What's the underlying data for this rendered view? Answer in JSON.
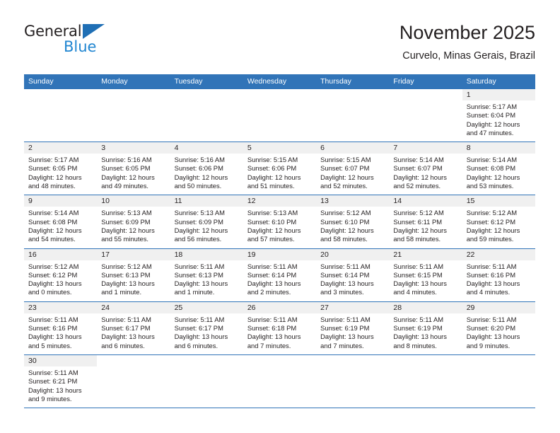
{
  "logo": {
    "word_top": "General",
    "word_bottom": "Blue",
    "icon": "triangle-flag-icon",
    "colors": {
      "black": "#231f20",
      "blue": "#2186d1",
      "flag": "#1f6fb5"
    }
  },
  "header": {
    "title": "November 2025",
    "subtitle": "Curvelo, Minas Gerais, Brazil"
  },
  "theme": {
    "header_blue": "#3174b8",
    "day_band_gray": "#f0f0f0",
    "text": "#231f20"
  },
  "weekdays": [
    "Sunday",
    "Monday",
    "Tuesday",
    "Wednesday",
    "Thursday",
    "Friday",
    "Saturday"
  ],
  "weeks": [
    [
      {
        "day": "",
        "empty": true,
        "blank": true,
        "sunrise": "",
        "sunset": "",
        "daylight_1": "",
        "daylight_2": ""
      },
      {
        "day": "",
        "empty": true,
        "blank": true,
        "sunrise": "",
        "sunset": "",
        "daylight_1": "",
        "daylight_2": ""
      },
      {
        "day": "",
        "empty": true,
        "blank": true,
        "sunrise": "",
        "sunset": "",
        "daylight_1": "",
        "daylight_2": ""
      },
      {
        "day": "",
        "empty": true,
        "blank": true,
        "sunrise": "",
        "sunset": "",
        "daylight_1": "",
        "daylight_2": ""
      },
      {
        "day": "",
        "empty": true,
        "blank": true,
        "sunrise": "",
        "sunset": "",
        "daylight_1": "",
        "daylight_2": ""
      },
      {
        "day": "",
        "empty": true,
        "blank": true,
        "sunrise": "",
        "sunset": "",
        "daylight_1": "",
        "daylight_2": ""
      },
      {
        "day": "1",
        "sunrise": "Sunrise: 5:17 AM",
        "sunset": "Sunset: 6:04 PM",
        "daylight_1": "Daylight: 12 hours",
        "daylight_2": "and 47 minutes."
      }
    ],
    [
      {
        "day": "2",
        "sunrise": "Sunrise: 5:17 AM",
        "sunset": "Sunset: 6:05 PM",
        "daylight_1": "Daylight: 12 hours",
        "daylight_2": "and 48 minutes."
      },
      {
        "day": "3",
        "sunrise": "Sunrise: 5:16 AM",
        "sunset": "Sunset: 6:05 PM",
        "daylight_1": "Daylight: 12 hours",
        "daylight_2": "and 49 minutes."
      },
      {
        "day": "4",
        "sunrise": "Sunrise: 5:16 AM",
        "sunset": "Sunset: 6:06 PM",
        "daylight_1": "Daylight: 12 hours",
        "daylight_2": "and 50 minutes."
      },
      {
        "day": "5",
        "sunrise": "Sunrise: 5:15 AM",
        "sunset": "Sunset: 6:06 PM",
        "daylight_1": "Daylight: 12 hours",
        "daylight_2": "and 51 minutes."
      },
      {
        "day": "6",
        "sunrise": "Sunrise: 5:15 AM",
        "sunset": "Sunset: 6:07 PM",
        "daylight_1": "Daylight: 12 hours",
        "daylight_2": "and 52 minutes."
      },
      {
        "day": "7",
        "sunrise": "Sunrise: 5:14 AM",
        "sunset": "Sunset: 6:07 PM",
        "daylight_1": "Daylight: 12 hours",
        "daylight_2": "and 52 minutes."
      },
      {
        "day": "8",
        "sunrise": "Sunrise: 5:14 AM",
        "sunset": "Sunset: 6:08 PM",
        "daylight_1": "Daylight: 12 hours",
        "daylight_2": "and 53 minutes."
      }
    ],
    [
      {
        "day": "9",
        "sunrise": "Sunrise: 5:14 AM",
        "sunset": "Sunset: 6:08 PM",
        "daylight_1": "Daylight: 12 hours",
        "daylight_2": "and 54 minutes."
      },
      {
        "day": "10",
        "sunrise": "Sunrise: 5:13 AM",
        "sunset": "Sunset: 6:09 PM",
        "daylight_1": "Daylight: 12 hours",
        "daylight_2": "and 55 minutes."
      },
      {
        "day": "11",
        "sunrise": "Sunrise: 5:13 AM",
        "sunset": "Sunset: 6:09 PM",
        "daylight_1": "Daylight: 12 hours",
        "daylight_2": "and 56 minutes."
      },
      {
        "day": "12",
        "sunrise": "Sunrise: 5:13 AM",
        "sunset": "Sunset: 6:10 PM",
        "daylight_1": "Daylight: 12 hours",
        "daylight_2": "and 57 minutes."
      },
      {
        "day": "13",
        "sunrise": "Sunrise: 5:12 AM",
        "sunset": "Sunset: 6:10 PM",
        "daylight_1": "Daylight: 12 hours",
        "daylight_2": "and 58 minutes."
      },
      {
        "day": "14",
        "sunrise": "Sunrise: 5:12 AM",
        "sunset": "Sunset: 6:11 PM",
        "daylight_1": "Daylight: 12 hours",
        "daylight_2": "and 58 minutes."
      },
      {
        "day": "15",
        "sunrise": "Sunrise: 5:12 AM",
        "sunset": "Sunset: 6:12 PM",
        "daylight_1": "Daylight: 12 hours",
        "daylight_2": "and 59 minutes."
      }
    ],
    [
      {
        "day": "16",
        "sunrise": "Sunrise: 5:12 AM",
        "sunset": "Sunset: 6:12 PM",
        "daylight_1": "Daylight: 13 hours",
        "daylight_2": "and 0 minutes."
      },
      {
        "day": "17",
        "sunrise": "Sunrise: 5:12 AM",
        "sunset": "Sunset: 6:13 PM",
        "daylight_1": "Daylight: 13 hours",
        "daylight_2": "and 1 minute."
      },
      {
        "day": "18",
        "sunrise": "Sunrise: 5:11 AM",
        "sunset": "Sunset: 6:13 PM",
        "daylight_1": "Daylight: 13 hours",
        "daylight_2": "and 1 minute."
      },
      {
        "day": "19",
        "sunrise": "Sunrise: 5:11 AM",
        "sunset": "Sunset: 6:14 PM",
        "daylight_1": "Daylight: 13 hours",
        "daylight_2": "and 2 minutes."
      },
      {
        "day": "20",
        "sunrise": "Sunrise: 5:11 AM",
        "sunset": "Sunset: 6:14 PM",
        "daylight_1": "Daylight: 13 hours",
        "daylight_2": "and 3 minutes."
      },
      {
        "day": "21",
        "sunrise": "Sunrise: 5:11 AM",
        "sunset": "Sunset: 6:15 PM",
        "daylight_1": "Daylight: 13 hours",
        "daylight_2": "and 4 minutes."
      },
      {
        "day": "22",
        "sunrise": "Sunrise: 5:11 AM",
        "sunset": "Sunset: 6:16 PM",
        "daylight_1": "Daylight: 13 hours",
        "daylight_2": "and 4 minutes."
      }
    ],
    [
      {
        "day": "23",
        "sunrise": "Sunrise: 5:11 AM",
        "sunset": "Sunset: 6:16 PM",
        "daylight_1": "Daylight: 13 hours",
        "daylight_2": "and 5 minutes."
      },
      {
        "day": "24",
        "sunrise": "Sunrise: 5:11 AM",
        "sunset": "Sunset: 6:17 PM",
        "daylight_1": "Daylight: 13 hours",
        "daylight_2": "and 6 minutes."
      },
      {
        "day": "25",
        "sunrise": "Sunrise: 5:11 AM",
        "sunset": "Sunset: 6:17 PM",
        "daylight_1": "Daylight: 13 hours",
        "daylight_2": "and 6 minutes."
      },
      {
        "day": "26",
        "sunrise": "Sunrise: 5:11 AM",
        "sunset": "Sunset: 6:18 PM",
        "daylight_1": "Daylight: 13 hours",
        "daylight_2": "and 7 minutes."
      },
      {
        "day": "27",
        "sunrise": "Sunrise: 5:11 AM",
        "sunset": "Sunset: 6:19 PM",
        "daylight_1": "Daylight: 13 hours",
        "daylight_2": "and 7 minutes."
      },
      {
        "day": "28",
        "sunrise": "Sunrise: 5:11 AM",
        "sunset": "Sunset: 6:19 PM",
        "daylight_1": "Daylight: 13 hours",
        "daylight_2": "and 8 minutes."
      },
      {
        "day": "29",
        "sunrise": "Sunrise: 5:11 AM",
        "sunset": "Sunset: 6:20 PM",
        "daylight_1": "Daylight: 13 hours",
        "daylight_2": "and 9 minutes."
      }
    ],
    [
      {
        "day": "30",
        "sunrise": "Sunrise: 5:11 AM",
        "sunset": "Sunset: 6:21 PM",
        "daylight_1": "Daylight: 13 hours",
        "daylight_2": "and 9 minutes."
      },
      {
        "day": "",
        "empty": true,
        "blank": true,
        "sunrise": "",
        "sunset": "",
        "daylight_1": "",
        "daylight_2": ""
      },
      {
        "day": "",
        "empty": true,
        "blank": true,
        "sunrise": "",
        "sunset": "",
        "daylight_1": "",
        "daylight_2": ""
      },
      {
        "day": "",
        "empty": true,
        "blank": true,
        "sunrise": "",
        "sunset": "",
        "daylight_1": "",
        "daylight_2": ""
      },
      {
        "day": "",
        "empty": true,
        "blank": true,
        "sunrise": "",
        "sunset": "",
        "daylight_1": "",
        "daylight_2": ""
      },
      {
        "day": "",
        "empty": true,
        "blank": true,
        "sunrise": "",
        "sunset": "",
        "daylight_1": "",
        "daylight_2": ""
      },
      {
        "day": "",
        "empty": true,
        "blank": true,
        "sunrise": "",
        "sunset": "",
        "daylight_1": "",
        "daylight_2": ""
      }
    ]
  ]
}
